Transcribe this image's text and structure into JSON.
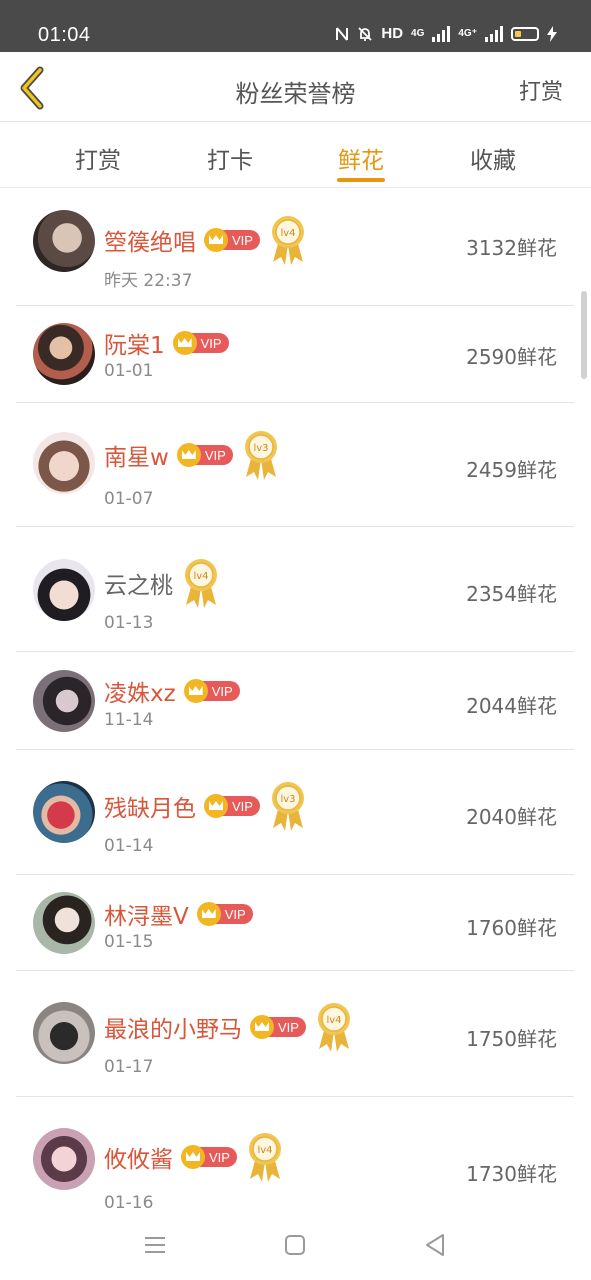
{
  "status_bar": {
    "time": "01:04",
    "indicators": "HD",
    "network_1": "4G",
    "network_2": "4G⁺"
  },
  "header": {
    "title": "粉丝荣誉榜",
    "right_action": "打赏"
  },
  "tabs": [
    {
      "label": "打赏",
      "active": false
    },
    {
      "label": "打卡",
      "active": false
    },
    {
      "label": "鲜花",
      "active": true
    },
    {
      "label": "收藏",
      "active": false
    }
  ],
  "vip_label": "VIP",
  "score_suffix": "鲜花",
  "rows": [
    {
      "name": "箜篌绝唱",
      "vip": true,
      "level": "lv4",
      "date": "昨天 22:37",
      "score": "3132鲜花"
    },
    {
      "name": "阮棠1",
      "vip": true,
      "level": "",
      "date": "01-01",
      "score": "2590鲜花"
    },
    {
      "name": "南星w",
      "vip": true,
      "level": "lv3",
      "date": "01-07",
      "score": "2459鲜花"
    },
    {
      "name": "云之桃",
      "vip": false,
      "level": "lv4",
      "date": "01-13",
      "score": "2354鲜花"
    },
    {
      "name": "凌姝xz",
      "vip": true,
      "level": "",
      "date": "11-14",
      "score": "2044鲜花"
    },
    {
      "name": "残缺月色",
      "vip": true,
      "level": "lv3",
      "date": "01-14",
      "score": "2040鲜花"
    },
    {
      "name": "林浔墨V",
      "vip": true,
      "level": "",
      "date": "01-15",
      "score": "1760鲜花"
    },
    {
      "name": "最浪的小野马",
      "vip": true,
      "level": "lv4",
      "date": "01-17",
      "score": "1750鲜花"
    },
    {
      "name": "攸攸酱",
      "vip": true,
      "level": "lv4",
      "date": "01-16",
      "score": "1730鲜花"
    }
  ],
  "colors": {
    "accent": "#e8960f",
    "name_vip": "#d9563a",
    "vip_badge": "#e75a5a",
    "crown": "#f3b623",
    "medal": "#e8b43a"
  }
}
